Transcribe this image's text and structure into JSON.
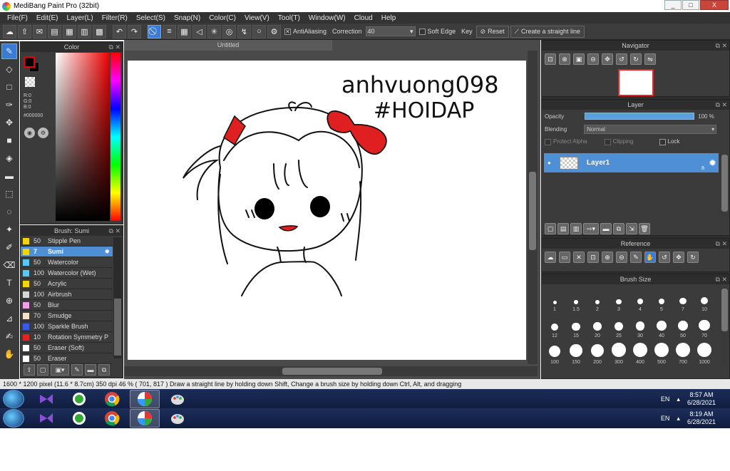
{
  "window": {
    "title": "MediBang Paint Pro (32bit)",
    "minimize": "_",
    "maximize": "□",
    "close": "X"
  },
  "menu": [
    "File(F)",
    "Edit(E)",
    "Layer(L)",
    "Filter(R)",
    "Select(S)",
    "Snap(N)",
    "Color(C)",
    "View(V)",
    "Tool(T)",
    "Window(W)",
    "Cloud",
    "Help"
  ],
  "toolbar": {
    "antialiasing": "AntiAliasing",
    "correction_label": "Correction",
    "correction_value": "40",
    "soft_edge": "Soft Edge",
    "key": "Key",
    "reset": "Reset",
    "straight": "Create a straight line"
  },
  "color_panel": {
    "title": "Color",
    "r": "R:0",
    "g": "G:0",
    "b": "B:0",
    "hex": "#000000",
    "fg": "#000000"
  },
  "brush_panel": {
    "title": "Brush: Sumi",
    "items": [
      {
        "size": "50",
        "name": "Stipple Pen",
        "color": "#f2d40a"
      },
      {
        "size": "7",
        "name": "Sumi",
        "color": "#f2d40a",
        "selected": true
      },
      {
        "size": "50",
        "name": "Watercolor",
        "color": "#58c8f0"
      },
      {
        "size": "100",
        "name": "Watercolor (Wet)",
        "color": "#58c8f0"
      },
      {
        "size": "50",
        "name": "Acrylic",
        "color": "#f2d40a"
      },
      {
        "size": "100",
        "name": "Airbrush",
        "color": "#d8d8d8"
      },
      {
        "size": "50",
        "name": "Blur",
        "color": "#f0a0e8"
      },
      {
        "size": "70",
        "name": "Smudge",
        "color": "#f8e0c8"
      },
      {
        "size": "100",
        "name": "Sparkle Brush",
        "color": "#3a5ae8"
      },
      {
        "size": "10",
        "name": "Rotation Symmetry P",
        "color": "#e82020"
      },
      {
        "size": "50",
        "name": "Eraser (Soft)",
        "color": "#ffffff"
      },
      {
        "size": "50",
        "name": "Eraser",
        "color": "#ffffff"
      }
    ]
  },
  "document": {
    "tab": "Untitled",
    "signature_line1": "anhvuong098",
    "signature_line2": "#HOIDAP"
  },
  "navigator": {
    "title": "Navigator"
  },
  "layer_panel": {
    "title": "Layer",
    "opacity_label": "Opacity",
    "opacity_value": "100 %",
    "opacity_fraction": 1.0,
    "blending_label": "Blending",
    "blending_value": "Normal",
    "protect_alpha": "Protect Alpha",
    "clipping": "Clipping",
    "lock": "Lock",
    "layer_name": "Layer1",
    "layer_depth": "8"
  },
  "reference": {
    "title": "Reference"
  },
  "brush_size": {
    "title": "Brush Size",
    "sizes": [
      "1",
      "1.5",
      "2",
      "3",
      "4",
      "5",
      "7",
      "10",
      "12",
      "15",
      "20",
      "25",
      "30",
      "40",
      "50",
      "70",
      "100",
      "150",
      "200",
      "300",
      "400",
      "500",
      "700",
      "1000"
    ]
  },
  "status": {
    "text": "1600 * 1200 pixel   (11.6 * 8.7cm)  350 dpi  46 %   ( 701, 817 )   Draw a straight line by holding down Shift, Change a brush size by holding down Ctrl, Alt, and dragging"
  },
  "taskbar1": {
    "lang": "EN",
    "time": "8:57 AM",
    "date": "6/28/2021"
  },
  "taskbar2": {
    "lang": "EN",
    "time": "8:19 AM",
    "date": "6/28/2021"
  }
}
